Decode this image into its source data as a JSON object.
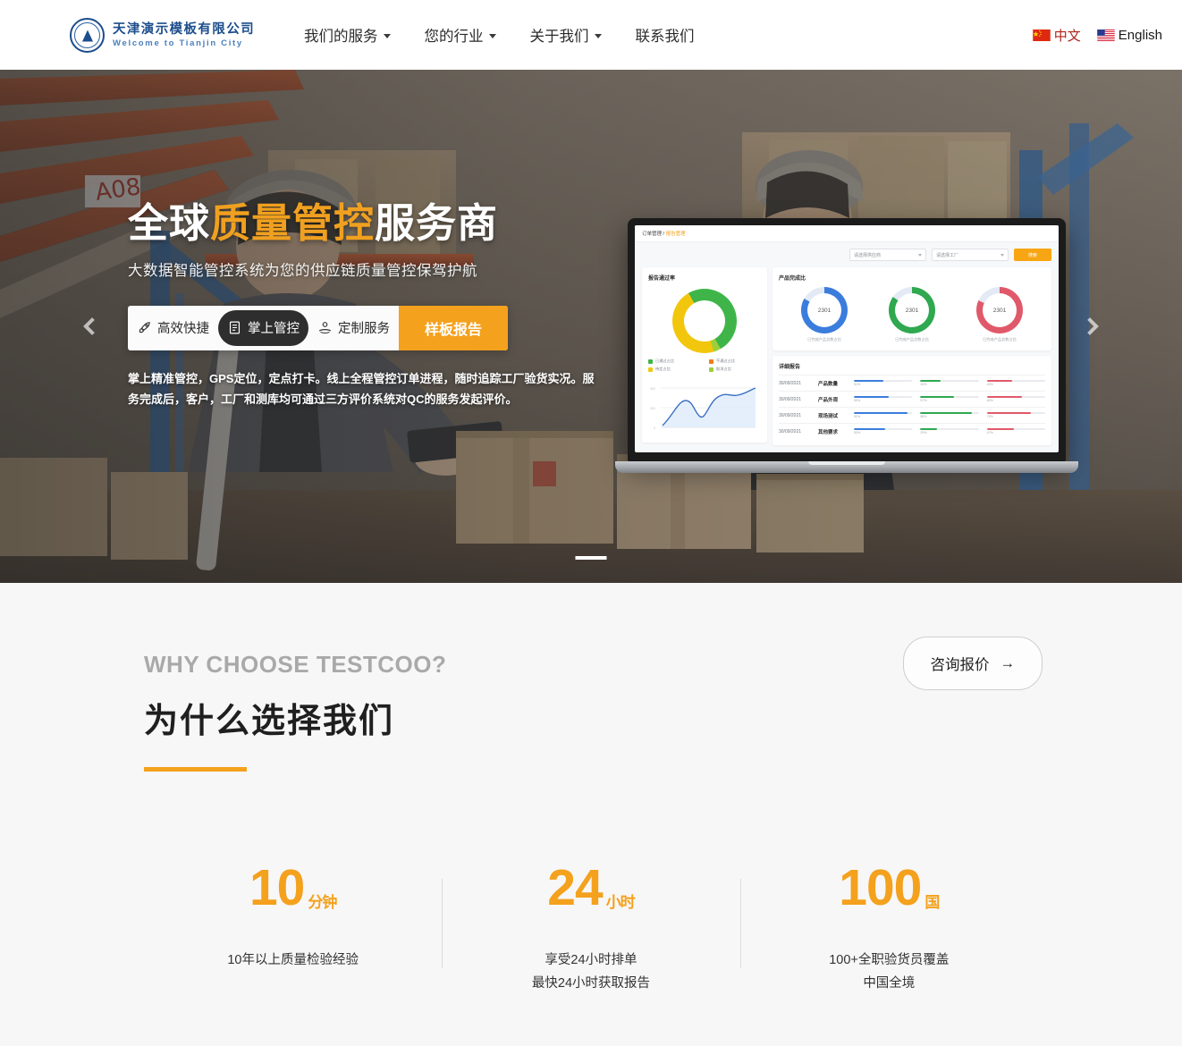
{
  "header": {
    "logo": {
      "cn": "天津演示模板有限公司",
      "en": "Welcome to Tianjin City"
    },
    "nav": [
      {
        "label": "我们的服务",
        "caret": true
      },
      {
        "label": "您的行业",
        "caret": true
      },
      {
        "label": "关于我们",
        "caret": true
      },
      {
        "label": "联系我们",
        "caret": false
      }
    ],
    "languages": [
      {
        "label": "中文",
        "flag": "cn-flag-icon"
      },
      {
        "label": "English",
        "flag": "us-flag-icon"
      }
    ]
  },
  "hero": {
    "title_pre": "全球",
    "title_hi": "质量管控",
    "title_post": "服务商",
    "subtitle": "大数据智能管控系统为您的供应链质量管控保驾护航",
    "tabs": [
      {
        "label": "高效快捷",
        "icon": "rocket-icon",
        "active": false
      },
      {
        "label": "掌上管控",
        "icon": "document-icon",
        "active": true
      },
      {
        "label": "定制服务",
        "icon": "hand-service-icon",
        "active": false
      }
    ],
    "cta": {
      "label": "样板报告"
    },
    "description": "掌上精准管控，GPS定位，定点打卡。线上全程管控订单进程，随时追踪工厂验货实况。服务完成后，客户，工厂和测库均可通过三方评价系统对QC的服务发起评价。",
    "accent_color": "#f4a11d",
    "dashboard": {
      "breadcrumb_parent": "订单管理",
      "breadcrumb_sep": " / ",
      "breadcrumb_current": "报告管理",
      "filters": [
        {
          "placeholder": "请选择供应商"
        },
        {
          "placeholder": "请选择工厂"
        }
      ],
      "search_label": "搜索",
      "pass_rate": {
        "title": "报告通过率",
        "legend": [
          {
            "label": "已通过占比",
            "color": "#3fb549"
          },
          {
            "label": "不通过占比",
            "color": "#f07c1a"
          },
          {
            "label": "待定占比",
            "color": "#f2c60d"
          },
          {
            "label": "取消占比",
            "color": "#9ccf3a"
          }
        ]
      },
      "completion": {
        "title": "产品完成比",
        "items": [
          {
            "value": "2301",
            "caption": "已完成产品总数占比",
            "color": "#3b7ddd"
          },
          {
            "value": "2301",
            "caption": "已完成产品总数占比",
            "color": "#2fa84f"
          },
          {
            "value": "2301",
            "caption": "已完成产品总数占比",
            "color": "#e0596a"
          }
        ]
      },
      "detail": {
        "title": "详细报告",
        "rows": [
          {
            "date": "30/09/2021",
            "name": "产品数量",
            "bars": [
              {
                "color": "#3b7ddd",
                "pct": 51,
                "label": "51%"
              },
              {
                "color": "#2fa84f",
                "pct": 34,
                "label": "34%"
              },
              {
                "color": "#e0596a",
                "pct": 43,
                "label": "43%"
              }
            ]
          },
          {
            "date": "30/09/2021",
            "name": "产品外观",
            "bars": [
              {
                "color": "#3b7ddd",
                "pct": 59,
                "label": "59%"
              },
              {
                "color": "#2fa84f",
                "pct": 57,
                "label": "57%"
              },
              {
                "color": "#e0596a",
                "pct": 60,
                "label": "60%"
              }
            ]
          },
          {
            "date": "30/09/2021",
            "name": "现场测试",
            "bars": [
              {
                "color": "#3b7ddd",
                "pct": 92,
                "label": "92%"
              },
              {
                "color": "#2fa84f",
                "pct": 88,
                "label": "88%"
              },
              {
                "color": "#e0596a",
                "pct": 75,
                "label": "75%"
              }
            ]
          },
          {
            "date": "30/09/2021",
            "name": "其他要求",
            "bars": [
              {
                "color": "#3b7ddd",
                "pct": 53,
                "label": "53%"
              },
              {
                "color": "#2fa84f",
                "pct": 29,
                "label": "29%"
              },
              {
                "color": "#e0596a",
                "pct": 47,
                "label": "47%"
              }
            ]
          }
        ]
      }
    }
  },
  "why": {
    "eyebrow": "WHY CHOOSE TESTCOO?",
    "title": "为什么选择我们",
    "quote_button": "咨询报价",
    "quote_arrow": "→",
    "stats": [
      {
        "number": "10",
        "unit": "分钟",
        "desc_line1": "10年以上质量检验经验",
        "desc_line2": ""
      },
      {
        "number": "24",
        "unit": "小时",
        "desc_line1": "享受24小时排单",
        "desc_line2": "最快24小时获取报告"
      },
      {
        "number": "100",
        "unit": "国",
        "desc_line1": "100+全职验货员覆盖",
        "desc_line2": "中国全境"
      }
    ]
  }
}
